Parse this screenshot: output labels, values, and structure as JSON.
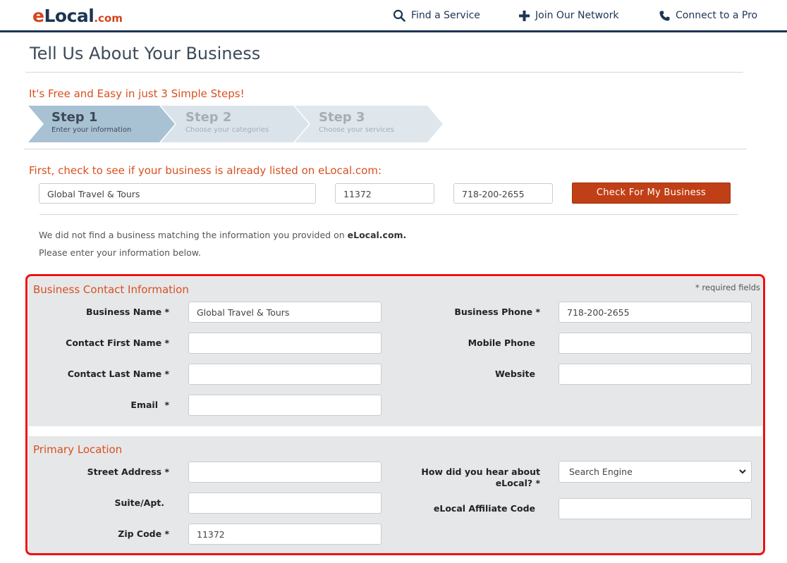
{
  "header": {
    "logo_main": "eLocal",
    "logo_e": "e",
    "logo_rest": "Local",
    "logo_suffix": ".com",
    "nav": {
      "find_service": "Find a Service",
      "join_network": "Join Our Network",
      "connect_pro": "Connect to a Pro"
    }
  },
  "page": {
    "title": "Tell Us About Your Business",
    "subtitle": "It's Free and Easy in just 3 Simple Steps!"
  },
  "steps": [
    {
      "title": "Step 1",
      "subtitle": "Enter your information"
    },
    {
      "title": "Step 2",
      "subtitle": "Choose your categories"
    },
    {
      "title": "Step 3",
      "subtitle": "Choose your services"
    }
  ],
  "check": {
    "heading": "First, check to see if your business is already listed on eLocal.com:",
    "business_name": "Global Travel & Tours",
    "zip": "11372",
    "phone": "718-200-2655",
    "button": "Check For My Business"
  },
  "message": {
    "line1_prefix": "We did not find a business matching the information you provided on ",
    "line1_brand": "eLocal.com.",
    "line2": "Please enter your information below."
  },
  "contact": {
    "section_title": "Business Contact Information",
    "required_note": "* required fields",
    "business_name_label": "Business Name *",
    "business_name_value": "Global Travel & Tours",
    "first_name_label": "Contact First Name *",
    "first_name_value": "",
    "last_name_label": "Contact Last Name *",
    "last_name_value": "",
    "email_label": "Email",
    "email_star": "*",
    "email_value": "",
    "business_phone_label": "Business Phone *",
    "business_phone_value": "718-200-2655",
    "mobile_phone_label": "Mobile Phone",
    "mobile_phone_value": "",
    "website_label": "Website",
    "website_value": ""
  },
  "location": {
    "section_title": "Primary Location",
    "street_label": "Street Address *",
    "street_value": "",
    "suite_label": "Suite/Apt.",
    "suite_value": "",
    "zip_label": "Zip Code *",
    "zip_value": "11372",
    "hear_label_line1": "How did you hear about",
    "hear_label_line2": "eLocal? *",
    "hear_selected": "Search Engine",
    "affiliate_label": "eLocal Affiliate Code",
    "affiliate_value": ""
  },
  "colors": {
    "brand_navy": "#1c3555",
    "brand_orange": "#d9501f",
    "button": "#c13f16",
    "highlight": "#ee1111",
    "panel": "#e6e7e9"
  }
}
